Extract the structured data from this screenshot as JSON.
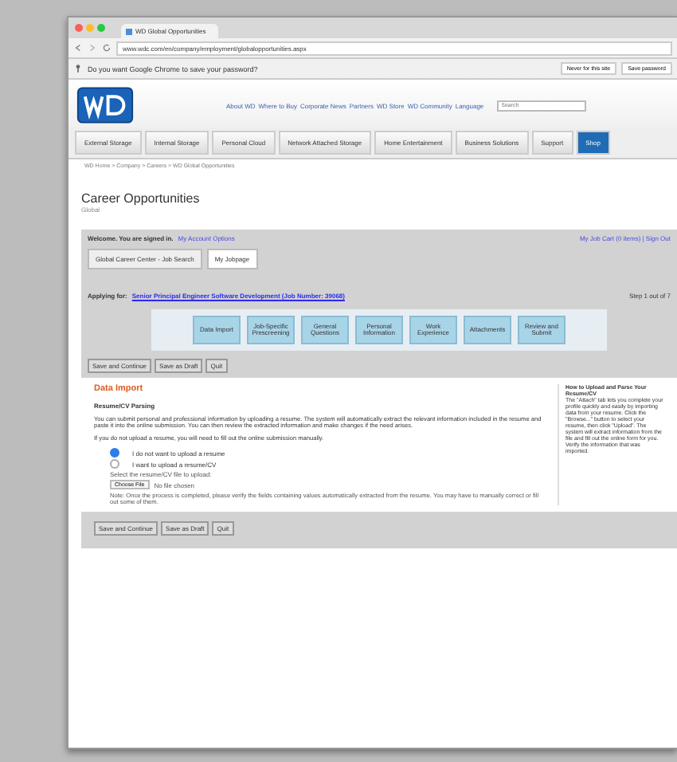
{
  "browser": {
    "tab_title": "WD Global Opportunities",
    "address": "www.wdc.com/en/company/employment/globalopportunities.aspx",
    "password_prompt": "Do you want Google Chrome to save your password?",
    "prompt_buttons": [
      "Never for this site",
      "Save password"
    ]
  },
  "site": {
    "top_links": [
      "About WD",
      "Where to Buy",
      "Corporate News",
      "Partners",
      "WD Store",
      "WD Community",
      "Language"
    ],
    "search_placeholder": "Search",
    "nav": [
      {
        "label": "External Storage",
        "selected": false
      },
      {
        "label": "Internal Storage",
        "selected": false
      },
      {
        "label": "Personal Cloud",
        "selected": false
      },
      {
        "label": "Network Attached Storage",
        "selected": false
      },
      {
        "label": "Home Entertainment",
        "selected": false
      },
      {
        "label": "Business Solutions",
        "selected": false
      },
      {
        "label": "Support",
        "selected": false
      },
      {
        "label": "Shop",
        "selected": true
      }
    ],
    "breadcrumb": "WD Home > Company > Careers > WD Global Opportunities"
  },
  "page": {
    "title": "Career Opportunities",
    "subtitle": "Global"
  },
  "panel": {
    "welcome": "Welcome. You are signed in.",
    "account_link": "My Account Options",
    "right_links": "My Job Cart (0 items) | Sign Out",
    "tabs": [
      {
        "label": "Global Career Center - Job Search",
        "selected": false
      },
      {
        "label": "My Jobpage",
        "selected": true
      }
    ],
    "applying_label": "Applying for:",
    "job_link": "Senior Principal Engineer Software Development (Job Number: 39068)",
    "step": "Step 1 out of 7",
    "steps": [
      "Data Import",
      "Job-Specific Prescreening",
      "General Questions",
      "Personal Information",
      "Work Experience",
      "Attachments",
      "Review and Submit"
    ],
    "buttons": [
      "Save and Continue",
      "Save as Draft",
      "Quit"
    ]
  },
  "section": {
    "title": "Data Import",
    "subtitle": "Resume/CV Parsing",
    "paragraphs": [
      "You can submit personal and professional information by uploading a resume. The system will automatically extract the relevant information included in the resume and paste it into the online submission. You can then review the extracted information and make changes if the need arises.",
      "If you do not upload a resume, you will need to fill out the online submission manually."
    ],
    "options": [
      {
        "label": "I do not want to upload a resume",
        "selected": true
      },
      {
        "label": "I want to upload a resume/CV",
        "selected": false
      }
    ],
    "file_label": "Select the resume/CV file to upload:",
    "file_button": "Choose File",
    "file_status": "No file chosen",
    "note": "Note: Once the process is completed, please verify the fields containing values automatically extracted from the resume. You may have to manually correct or fill out some of them.",
    "help_title": "How to Upload and Parse Your Resume/CV",
    "help_text": "The \"Attach\" tab lets you complete your profile quickly and easily by importing data from your resume. Click the \"Browse...\" button to select your resume, then click \"Upload\". The system will extract information from the file and fill out the online form for you. Verify the information that was imported."
  },
  "bottom_buttons": [
    "Save and Continue",
    "Save as Draft",
    "Quit"
  ]
}
